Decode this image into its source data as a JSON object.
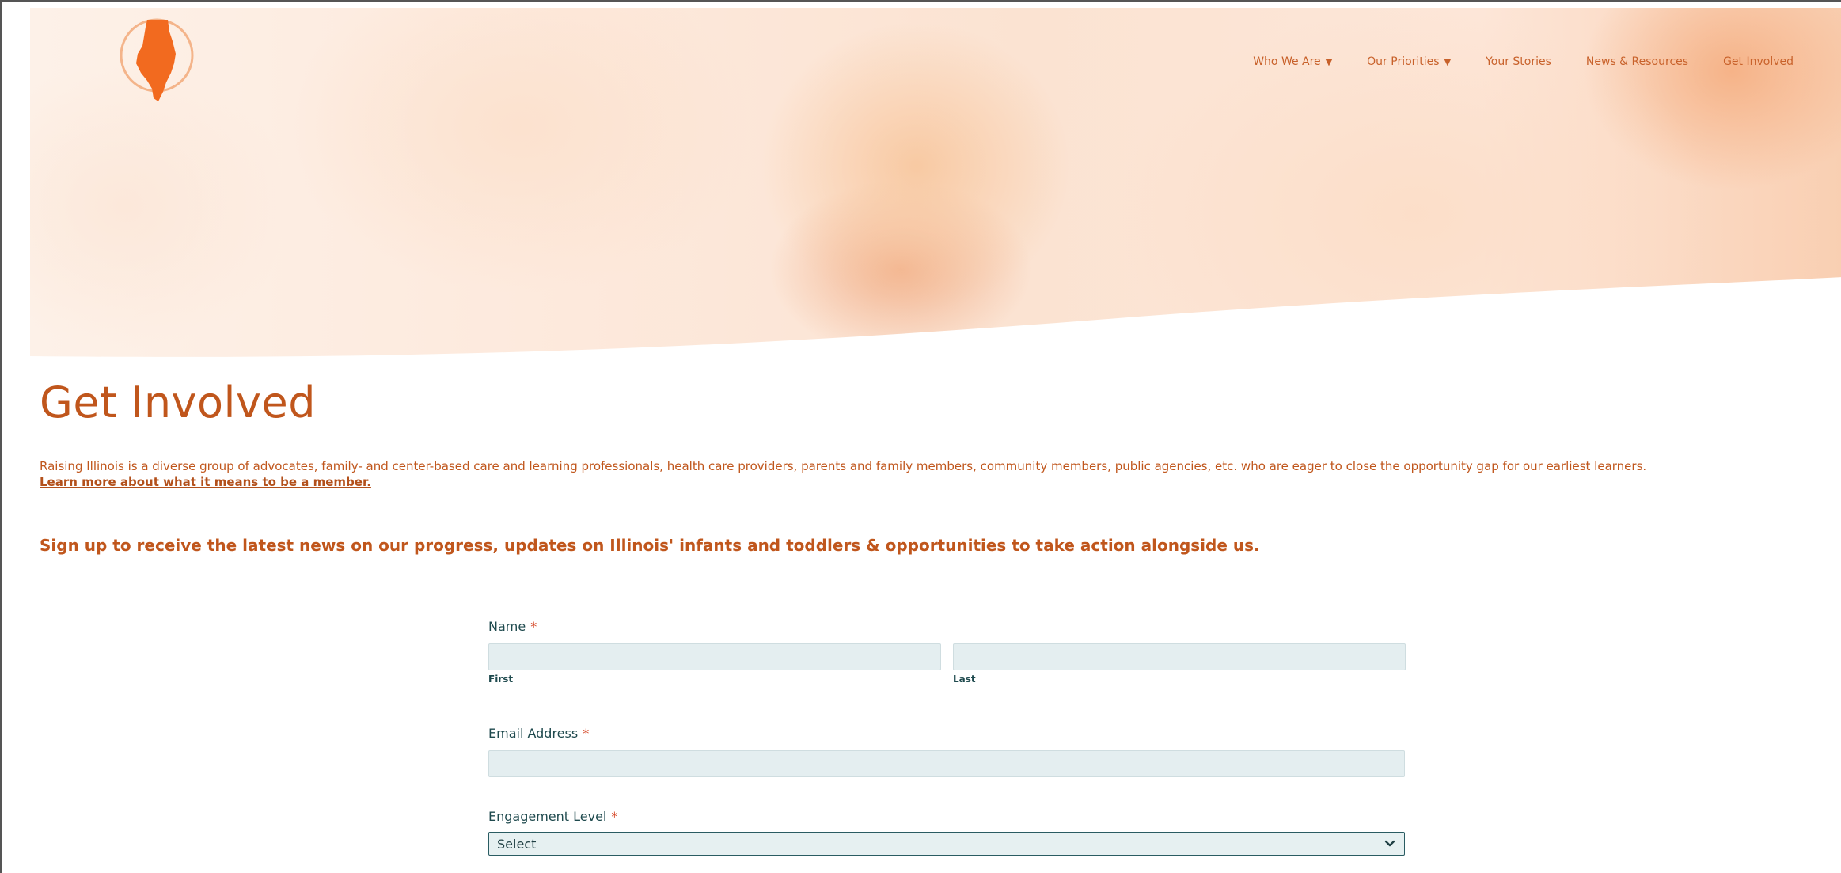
{
  "nav": {
    "items": [
      {
        "label": "Who We Are",
        "caret": "▼"
      },
      {
        "label": "Our Priorities",
        "caret": "▼"
      },
      {
        "label": "Your Stories",
        "caret": ""
      },
      {
        "label": "News & Resources",
        "caret": ""
      },
      {
        "label": "Get Involved",
        "caret": ""
      }
    ]
  },
  "logo": {
    "icon": "illinois-state-logo",
    "color": "#f26a1f"
  },
  "page": {
    "title": "Get Involved",
    "intro": "Raising Illinois is a diverse group of advocates, family- and center-based care and learning professionals, health care providers, parents and family members, community members, public agencies, etc. who are eager to close the opportunity gap for our earliest learners.",
    "intro_link": "Learn more about what it means to be a member.",
    "signup": "Sign up to receive the latest news on our progress, updates on Illinois' infants and toddlers & opportunities to take action alongside us."
  },
  "form": {
    "name_label": "Name",
    "required_mark": "*",
    "first_label": "First",
    "last_label": "Last",
    "email_label": "Email Address",
    "engagement_label": "Engagement Level",
    "engagement_value": "Select"
  },
  "colors": {
    "accent": "#c0561c",
    "form_text": "#1f4a4e",
    "input_bg": "#e4eef0"
  }
}
